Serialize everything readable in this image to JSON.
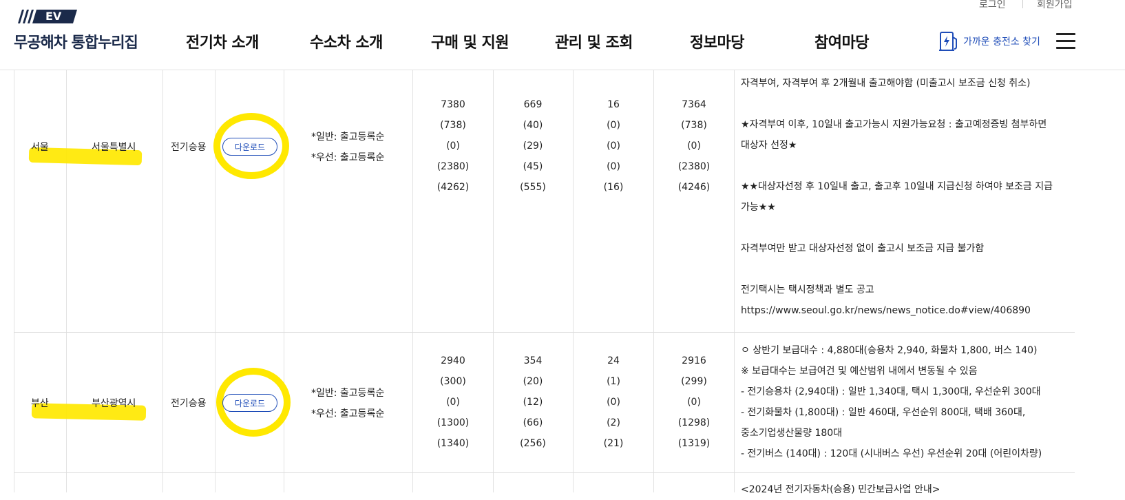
{
  "header": {
    "logo_badge": "EV",
    "site_title": "무공해차 통합누리집",
    "login": "로그인",
    "signup": "회원가입",
    "nav": [
      "전기차 소개",
      "수소차 소개",
      "구매 및 지원",
      "관리 및 조회",
      "정보마당",
      "참여마당"
    ],
    "charger_link": "가까운 충전소 찾기"
  },
  "rows": [
    {
      "region": "서울",
      "city": "서울특별시",
      "vehicle_type": "전기승용",
      "download_label": "다운로드",
      "order_general": "*일반: 출고등록순",
      "order_priority": "*우선: 출고등록순",
      "col1": [
        "7380",
        "(738)",
        "(0)",
        "(2380)",
        "(4262)"
      ],
      "col2": [
        "669",
        "(40)",
        "(29)",
        "(45)",
        "(555)"
      ],
      "col3": [
        "16",
        "(0)",
        "(0)",
        "(0)",
        "(16)"
      ],
      "col4": [
        "7364",
        "(738)",
        "(0)",
        "(2380)",
        "(4246)"
      ],
      "notes": [
        "자격부여, 자격부여 후 2개월내 출고해야함 (미출고시 보조금 신청 취소)",
        "",
        "★자격부여 이후, 10일내 출고가능시 지원가능요청 : 출고예정증빙 첨부하면",
        "대상자 선정★",
        "",
        "★★대상자선정 후 10일내 출고, 출고후 10일내 지급신청 하여야 보조금 지급",
        "가능★★",
        "",
        "자격부여만 받고 대상자선정 없이 출고시 보조금 지급 불가함",
        "",
        "전기택시는 택시정책과 별도 공고",
        "https://www.seoul.go.kr/news/news_notice.do#view/406890"
      ]
    },
    {
      "region": "부산",
      "city": "부산광역시",
      "vehicle_type": "전기승용",
      "download_label": "다운로드",
      "order_general": "*일반: 출고등록순",
      "order_priority": "*우선: 출고등록순",
      "col1": [
        "2940",
        "(300)",
        "(0)",
        "(1300)",
        "(1340)"
      ],
      "col2": [
        "354",
        "(20)",
        "(12)",
        "(66)",
        "(256)"
      ],
      "col3": [
        "24",
        "(1)",
        "(0)",
        "(2)",
        "(21)"
      ],
      "col4": [
        "2916",
        "(299)",
        "(0)",
        "(1298)",
        "(1319)"
      ],
      "notes": [
        "ㅇ 상반기 보급대수 : 4,880대(승용차 2,940, 화물차 1,800, 버스 140)",
        "※ 보급대수는 보급여건 및 예산범위 내에서 변동될 수 있음",
        "- 전기승용차 (2,940대) : 일반 1,340대, 택시 1,300대, 우선순위 300대",
        "- 전기화물차 (1,800대) : 일반 460대, 우선순위 800대, 택배 360대,",
        "중소기업생산물량 180대",
        "- 전기버스 (140대) : 120대 (시내버스 우선) 우선순위 20대 (어린이차량)"
      ]
    }
  ],
  "next_row_note": "<2024년 전기자동차(승용) 민간보급사업 안내>",
  "colors": {
    "brand_navy": "#1b2a4a",
    "link_blue": "#1f4db8",
    "highlight": "#ffe800"
  }
}
